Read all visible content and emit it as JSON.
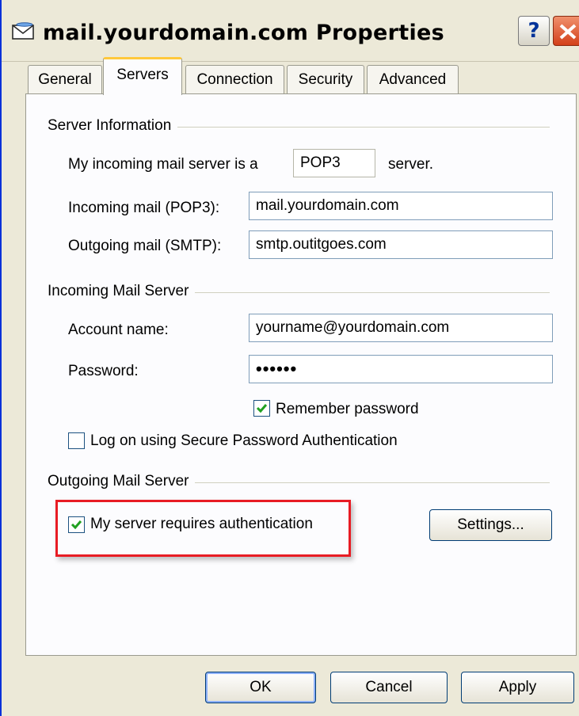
{
  "window": {
    "title": "mail.yourdomain.com Properties",
    "help_label": "?",
    "icon": "mail-envelope-icon",
    "close_icon": "close-icon"
  },
  "tabs": [
    "General",
    "Servers",
    "Connection",
    "Security",
    "Advanced"
  ],
  "server_info": {
    "group_label": "Server Information",
    "incoming_type_prefix": "My incoming mail server is a",
    "incoming_type_value": "POP3",
    "incoming_type_suffix": "server.",
    "incoming_label": "Incoming mail (POP3):",
    "incoming_value": "mail.yourdomain.com",
    "outgoing_label": "Outgoing mail (SMTP):",
    "outgoing_value": "smtp.outitgoes.com"
  },
  "incoming_server": {
    "group_label": "Incoming Mail Server",
    "account_label": "Account name:",
    "account_value": "yourname@yourdomain.com",
    "password_label": "Password:",
    "password_value": "••••••",
    "remember_label": "Remember password",
    "remember_checked": true,
    "spa_label": "Log on using Secure Password Authentication",
    "spa_checked": false
  },
  "outgoing_server": {
    "group_label": "Outgoing Mail Server",
    "auth_label": "My server requires authentication",
    "auth_checked": true,
    "settings_label": "Settings..."
  },
  "footer": {
    "ok_label": "OK",
    "cancel_label": "Cancel",
    "apply_label": "Apply"
  },
  "colors": {
    "highlight_border": "#e81c24",
    "active_tab_accent": "#ffc83c",
    "checkmark": "#21a121"
  }
}
